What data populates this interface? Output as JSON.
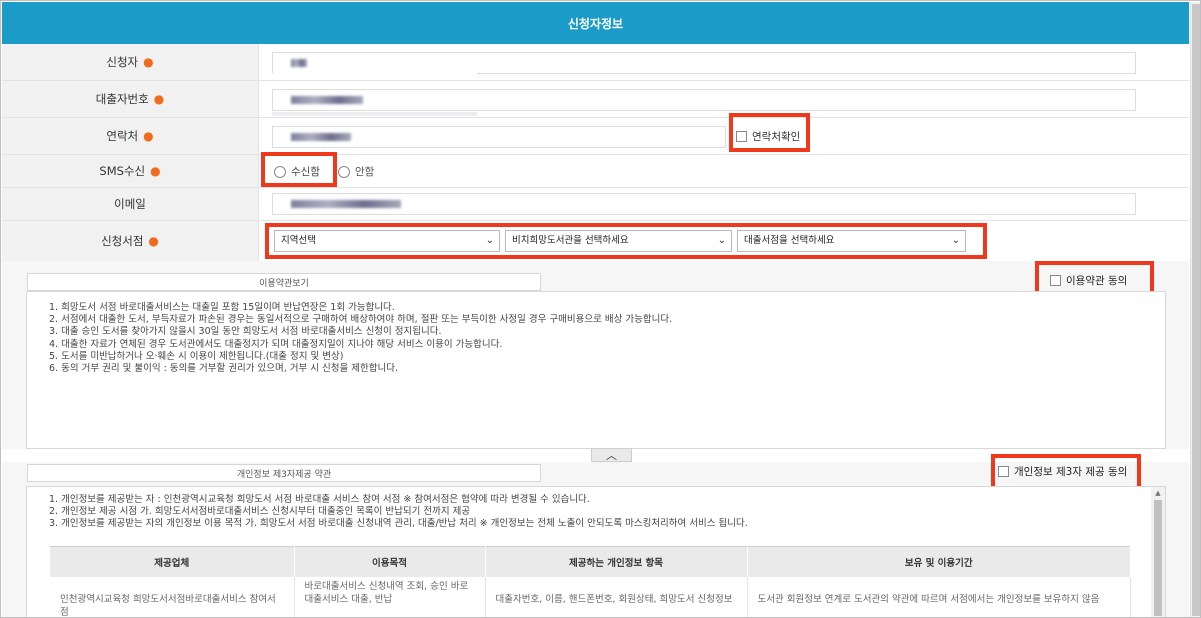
{
  "header": {
    "title": "신청자정보"
  },
  "form": {
    "applicant": {
      "label": "신청자"
    },
    "card_number": {
      "label": "대출자번호"
    },
    "contact": {
      "label": "연락처",
      "confirm_label": "연락처확인"
    },
    "sms": {
      "label": "SMS수신",
      "option_yes": "수신함",
      "option_no": "안함"
    },
    "email": {
      "label": "이메일"
    },
    "store": {
      "label": "신청서점",
      "region_select": "지역선택",
      "library_select": "비치희망도서관을 선택하세요",
      "bookstore_select": "대출서점을 선택하세요"
    }
  },
  "terms": {
    "tab_label": "이용약관보기",
    "agree_label": "이용약관 동의",
    "lines": [
      "1. 희망도서 서점 바로대출서비스는 대출일 포함 15일이며 반납연장은 1회 가능합니다.",
      "2. 서점에서 대출한 도서, 부득자료가 파손된 경우는 동일서적으로 구매하여 배상하여야 하며, 절판 또는 부득이한 사정일 경우 구매비용으로 배상 가능합니다.",
      "3. 대출 승인 도서를 찾아가지 않을시 30일 동안 희망도서 서점 바로대출서비스 신청이 정지됩니다.",
      "4. 대출한 자료가 연체된 경우 도서관에서도 대출정지가 되며 대출정지일이 지나야 해당 서비스 이용이 가능합니다.",
      "5. 도서를 미반납하거나 오·훼손 시 이용이 제한됩니다.(대출 정지 및 변상)",
      "6. 동의 거부 권리 및 불이익 : 동의를 거부할 권리가 있으며, 거부 시 신청을 제한합니다."
    ]
  },
  "privacy": {
    "tab_label": "개인정보 제3자제공 약관",
    "agree_label": "개인정보 제3자 제공 동의",
    "lines": [
      "1. 개인정보를 제공받는 자 : 인천광역시교육청 희망도서 서점 바로대출 서비스 참여 서점 ※ 참여서점은 협약에 따라 변경될 수 있습니다.",
      "2. 개인정보 제공 시점 가. 희망도서서점바로대출서비스 신청시부터 대출중인 목록이 반납되기 전까지 제공",
      "3. 개인정보를 제공받는 자의 개인정보 이용 목적 가. 희망도서 서점 바로대출 신청내역 관리, 대출/반납 처리 ※ 개인정보는 전체 노출이 안되도록 마스킹처리하여 서비스 됩니다."
    ],
    "table": {
      "headers": [
        "제공업체",
        "이용목적",
        "제공하는 개인정보 항목",
        "보유 및 이용기간"
      ],
      "row": [
        "인천광역시교육청 희망도서서점바로대출서비스 참여서점",
        "바로대출서비스 신청내역 조회, 승인 바로대출서비스 대출, 반납",
        "대출자번호, 이름, 핸드폰번호, 회원상태, 희망도서 신청정보",
        "도서관 회원정보 연계로 도서관의 약관에 따르며 서점에서는 개인정보를 보유하지 않음"
      ]
    }
  },
  "colors": {
    "header_bg": "#1b9bc8",
    "required_dot": "#f26a1b",
    "highlight": "#f0391c"
  }
}
